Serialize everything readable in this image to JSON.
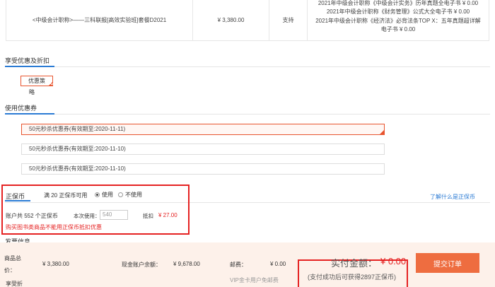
{
  "order": {
    "product_name": "<中级会计职称>——三科联报[高效实验班]套餐D2021",
    "price": "¥ 3,380.00",
    "status": "支持",
    "gifts": [
      "2021年中级会计职称《中级会计实务》历年真题全电子书 ¥ 0.00",
      "2021年中级会计职称《财务管理》公式大全电子书 ¥ 0.00",
      "2021年中级会计职称《经济法》必背法条TOP X：五年真题超详解",
      "电子书 ¥ 0.00"
    ]
  },
  "discount": {
    "title": "享受优惠及折扣",
    "policy_label": "优惠策",
    "policy_sub": "略"
  },
  "coupons": {
    "title": "使用优惠券",
    "items": [
      "50元秒杀优惠券(有效期至:2020-11-11)",
      "50元秒杀优惠券(有效期至:2020-11-10)",
      "50元秒杀优惠券(有效期至:2020-11-10)"
    ]
  },
  "coin": {
    "title": "正保币",
    "available": "满 20 正保币可用",
    "use_label": "使用",
    "nouse_label": "不使用",
    "link": "了解什么是正保币",
    "account_text": "账户共 552 个正保币",
    "use_input_label": "本次使用：",
    "input_placeholder": "540",
    "deduct_label": "抵扣",
    "deduct_amount": "¥ 27.00",
    "warning": "购买图书类商品不能用正保币抵扣优惠"
  },
  "invoice": {
    "title": "发票信息"
  },
  "summary": {
    "goods_total_label_1": "商品总",
    "goods_total_label_2": "价：",
    "goods_total_value": "¥ 3,380.00",
    "cash_balance_label": "现金账户余额：",
    "cash_balance_value": "¥ 9,678.00",
    "postage_label": "邮费：",
    "postage_value": "¥ 0.00",
    "vip_note": "VIP金卡用户免邮费",
    "enjoy_label": "享受折",
    "pay_label": "实付金额：",
    "pay_value": "¥ 0.00",
    "pay_sub": "(支付成功后可获得2897正保币)",
    "submit_label": "提交订单"
  },
  "colors": {
    "accent_blue": "#2b7bd4",
    "highlight_red": "#e52222",
    "button_orange": "#ee6d40",
    "summary_bg": "#fdf1ea"
  }
}
